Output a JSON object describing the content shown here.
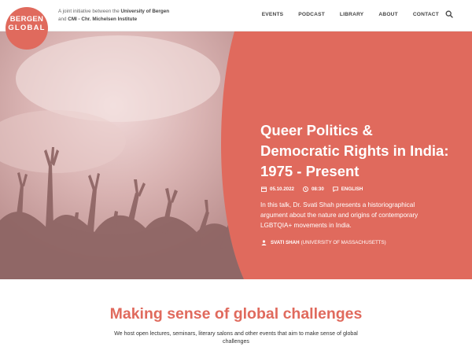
{
  "logo": {
    "line1": "BERGEN",
    "line2": "GLOBAL"
  },
  "header": {
    "tagline_prefix": "A joint initiative between the ",
    "tagline_org1": "University of Bergen",
    "tagline_and": "and ",
    "tagline_org2": "CMI - Chr. Michelsen Institute"
  },
  "nav": {
    "items": [
      "EVENTS",
      "PODCAST",
      "LIBRARY",
      "ABOUT",
      "CONTACT"
    ],
    "search_icon": "search-icon"
  },
  "hero": {
    "title": "Queer Politics & Democratic Rights in India: 1975 - Present",
    "date": "05.10.2022",
    "time": "08:30",
    "language": "ENGLISH",
    "description": "In this talk, Dr. Svati Shah presents a historiographical argument about the nature and origins of contemporary LGBTQIA+ movements in India.",
    "speaker_name": "SVATI SHAH",
    "speaker_affiliation": "(UNIVERSITY OF MASSACHUSETTS)"
  },
  "intro": {
    "title": "Making sense of global challenges",
    "text": "We host open lectures, seminars, literary salons and other events that aim to make sense of global challenges"
  },
  "colors": {
    "accent": "#e06a5d",
    "text": "#333333"
  }
}
